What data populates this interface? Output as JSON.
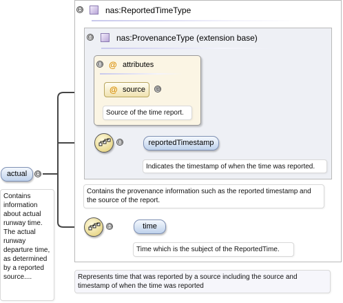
{
  "root_element": {
    "label": "actual",
    "doc": "Contains information about actual runway time. The actual runway departure time, as determined by a reported source...."
  },
  "reported_time_type": {
    "label": "nas:ReportedTimeType",
    "doc": "Represents time that was reported by a source including the source and timestamp of when the time was reported"
  },
  "provenance_type": {
    "label": "nas:ProvenanceType (extension base)",
    "doc": "Contains the provenance information such as the reported timestamp and the source of the report."
  },
  "attributes": {
    "label": "attributes",
    "at_symbol": "@",
    "source": {
      "label": "source",
      "doc": "Source of the time report."
    }
  },
  "elements": {
    "reported_timestamp": {
      "label": "reportedTimestamp",
      "doc": "Indicates the timestamp of when the time was reported."
    },
    "time": {
      "label": "time",
      "doc": "Time which is the subject of the ReportedTime."
    }
  },
  "glyphs": {
    "collapse": "⊖",
    "expand": "⊕"
  }
}
